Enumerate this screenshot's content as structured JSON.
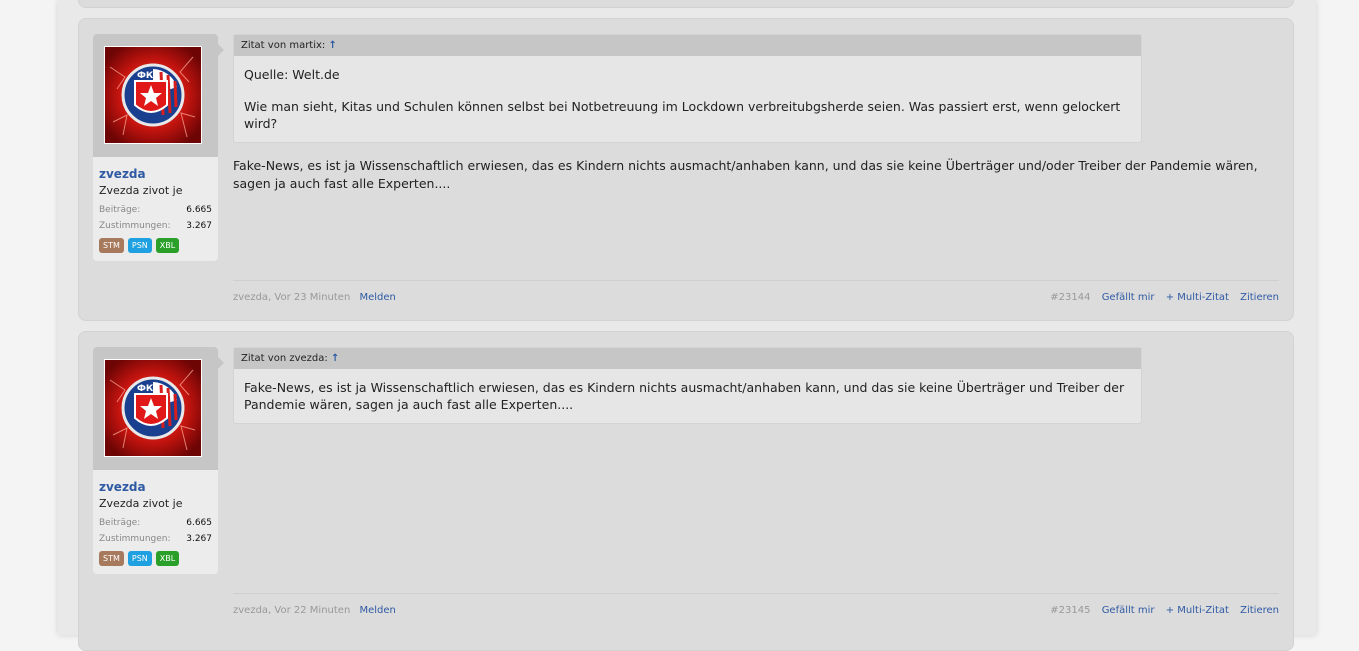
{
  "posts": [
    {
      "user": {
        "name": "zvezda",
        "title": "Zvezda zivot je",
        "stats": [
          {
            "label": "Beiträge:",
            "value": "6.665"
          },
          {
            "label": "Zustimmungen:",
            "value": "3.267"
          }
        ],
        "badges": [
          "STM",
          "PSN",
          "XBL"
        ]
      },
      "quote": {
        "header": "Zitat von martix:",
        "arrow": "↑",
        "paragraphs": [
          "Quelle: Welt.de",
          "Wie man sieht, Kitas und Schulen können selbst bei Notbetreuung im Lockdown verbreitubgsherde seien. Was passiert erst, wenn gelockert wird?"
        ]
      },
      "message": "Fake-News, es ist ja Wissenschaftlich erwiesen, das es Kindern nichts ausmacht/anhaben kann, und das sie keine Überträger und/oder Treiber der Pandemie wären, sagen ja auch fast alle Experten....",
      "footer": {
        "author": "zvezda",
        "time": "Vor 23 Minuten",
        "report": "Melden",
        "post_number": "#23144",
        "like": "Gefällt mir",
        "multiquote": "+ Multi-Zitat",
        "reply": "Zitieren"
      }
    },
    {
      "user": {
        "name": "zvezda",
        "title": "Zvezda zivot je",
        "stats": [
          {
            "label": "Beiträge:",
            "value": "6.665"
          },
          {
            "label": "Zustimmungen:",
            "value": "3.267"
          }
        ],
        "badges": [
          "STM",
          "PSN",
          "XBL"
        ]
      },
      "quote": {
        "header": "Zitat von zvezda:",
        "arrow": "↑",
        "paragraphs": [
          "Fake-News, es ist ja Wissenschaftlich erwiesen, das es Kindern nichts ausmacht/anhaben kann, und das sie keine Überträger und Treiber der Pandemie wären, sagen ja auch fast alle Experten...."
        ]
      },
      "message": "",
      "footer": {
        "author": "zvezda",
        "time": "Vor 22 Minuten",
        "report": "Melden",
        "post_number": "#23145",
        "like": "Gefällt mir",
        "multiquote": "+ Multi-Zitat",
        "reply": "Zitieren"
      }
    }
  ],
  "colors": {
    "link": "#2f5aa3",
    "post_bg": "#dcdcdc",
    "avatar_red": "#d81d1d"
  }
}
